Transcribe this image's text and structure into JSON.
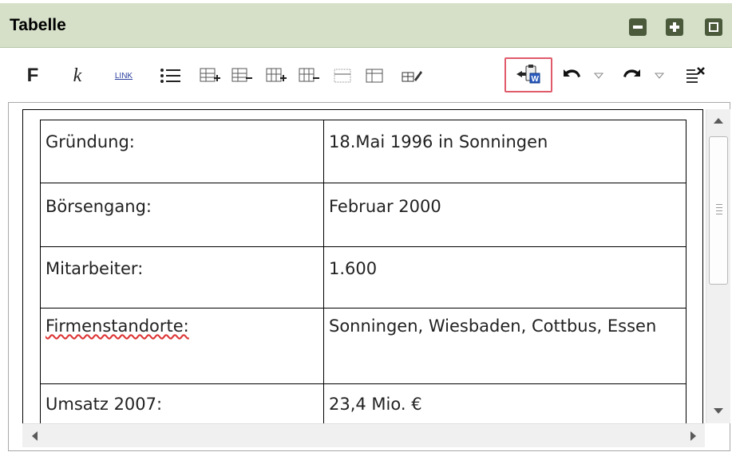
{
  "panel": {
    "title": "Tabelle",
    "window_buttons": [
      "minimize-icon",
      "maximize-icon",
      "restore-icon"
    ]
  },
  "toolbar": {
    "bold_label": "F",
    "italic_label": "k",
    "link_label": "LINK",
    "icons": [
      "bulleted-list-icon",
      "insert-row-icon",
      "delete-row-icon",
      "insert-column-icon",
      "delete-column-icon",
      "merge-cells-icon",
      "split-cells-icon",
      "table-properties-icon",
      "paste-from-word-icon",
      "undo-icon",
      "undo-dropdown-icon",
      "redo-icon",
      "redo-dropdown-icon",
      "clear-formatting-icon"
    ],
    "highlighted_icon": "paste-from-word-icon",
    "highlight_color": "#e05a6a"
  },
  "table": {
    "rows": [
      {
        "label": "Gründung:",
        "value": "18.Mai 1996 in Sonningen"
      },
      {
        "label": "Börsengang:",
        "value": "Februar 2000"
      },
      {
        "label": "Mitarbeiter:",
        "value": "1.600"
      },
      {
        "label": "Firmenstandorte:",
        "value": "Sonningen, Wiesbaden, Cottbus, Essen"
      },
      {
        "label": "Umsatz 2007:",
        "value": "23,4 Mio. €"
      }
    ]
  },
  "colors": {
    "titlebar_bg": "#d6e0c9",
    "window_button": "#4a5a3a",
    "spellcheck_underline": "#dd3333"
  }
}
